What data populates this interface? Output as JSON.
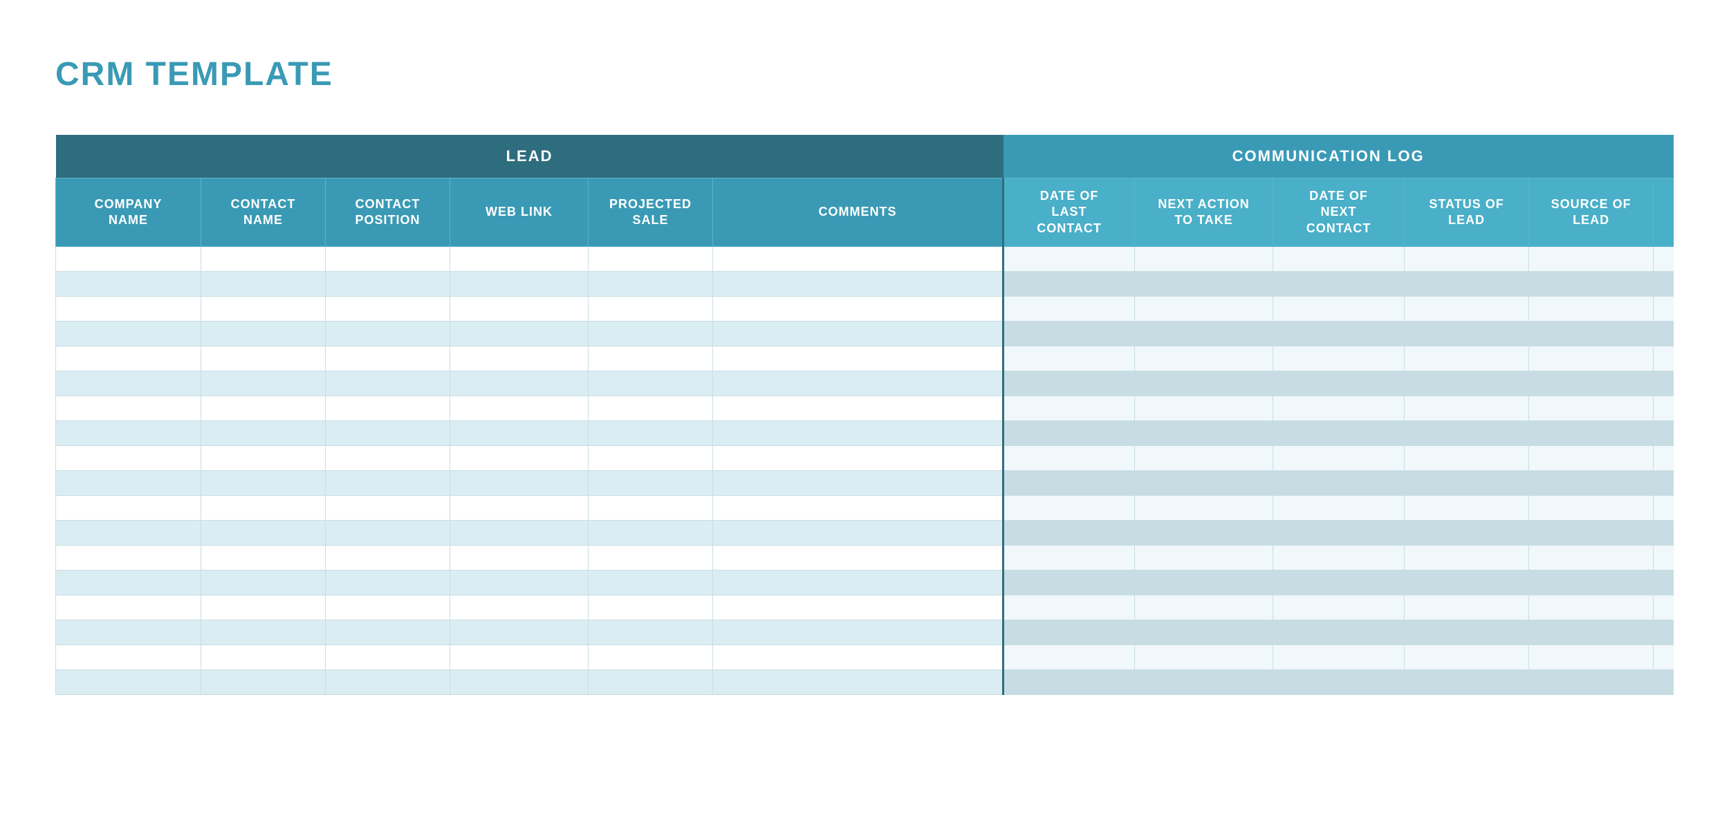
{
  "title": "CRM TEMPLATE",
  "sections": {
    "lead": {
      "label": "LEAD",
      "colspan": 6
    },
    "comm": {
      "label": "COMMUNICATION LOG",
      "colspan": 5
    },
    "extra": {
      "label": "",
      "colspan": 1
    }
  },
  "columns": [
    {
      "id": "company",
      "label": "COMPANY\nNAME",
      "section": "lead"
    },
    {
      "id": "contact-name",
      "label": "CONTACT\nNAME",
      "section": "lead"
    },
    {
      "id": "contact-pos",
      "label": "CONTACT\nPOSITION",
      "section": "lead"
    },
    {
      "id": "weblink",
      "label": "WEB LINK",
      "section": "lead"
    },
    {
      "id": "projected",
      "label": "PROJECTED\nSALE",
      "section": "lead"
    },
    {
      "id": "comments",
      "label": "COMMENTS",
      "section": "lead"
    },
    {
      "id": "date-last",
      "label": "DATE OF\nLAST\nCONTACT",
      "section": "comm"
    },
    {
      "id": "next-action",
      "label": "NEXT ACTION\nTO TAKE",
      "section": "comm"
    },
    {
      "id": "date-next",
      "label": "DATE OF\nNEXT\nCONTACT",
      "section": "comm"
    },
    {
      "id": "status",
      "label": "STATUS OF\nLEAD",
      "section": "comm"
    },
    {
      "id": "source",
      "label": "SOURCE OF\nLEAD",
      "section": "comm"
    },
    {
      "id": "extra",
      "label": "",
      "section": "extra"
    }
  ],
  "row_count": 18
}
